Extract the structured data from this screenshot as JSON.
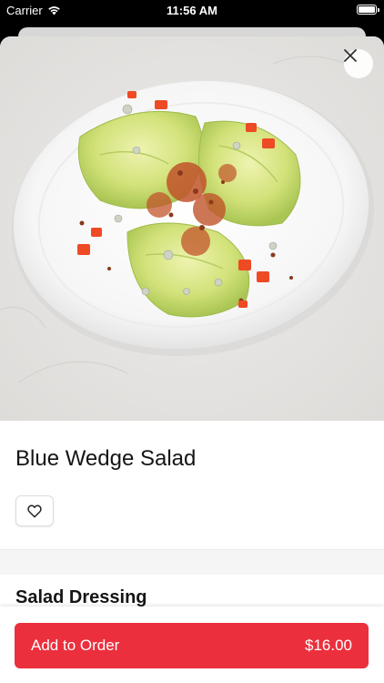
{
  "status_bar": {
    "carrier": "Carrier",
    "time": "11:56 AM"
  },
  "item": {
    "name": "Blue Wedge Salad"
  },
  "sections": {
    "dressing_title": "Salad Dressing"
  },
  "footer": {
    "add_label": "Add to Order",
    "price": "$16.00"
  },
  "icons": {
    "close": "close-icon",
    "favorite": "heart-outline-icon",
    "wifi": "wifi-icon",
    "battery": "battery-icon"
  },
  "colors": {
    "accent": "#eb2f3d",
    "title": "#151515"
  }
}
